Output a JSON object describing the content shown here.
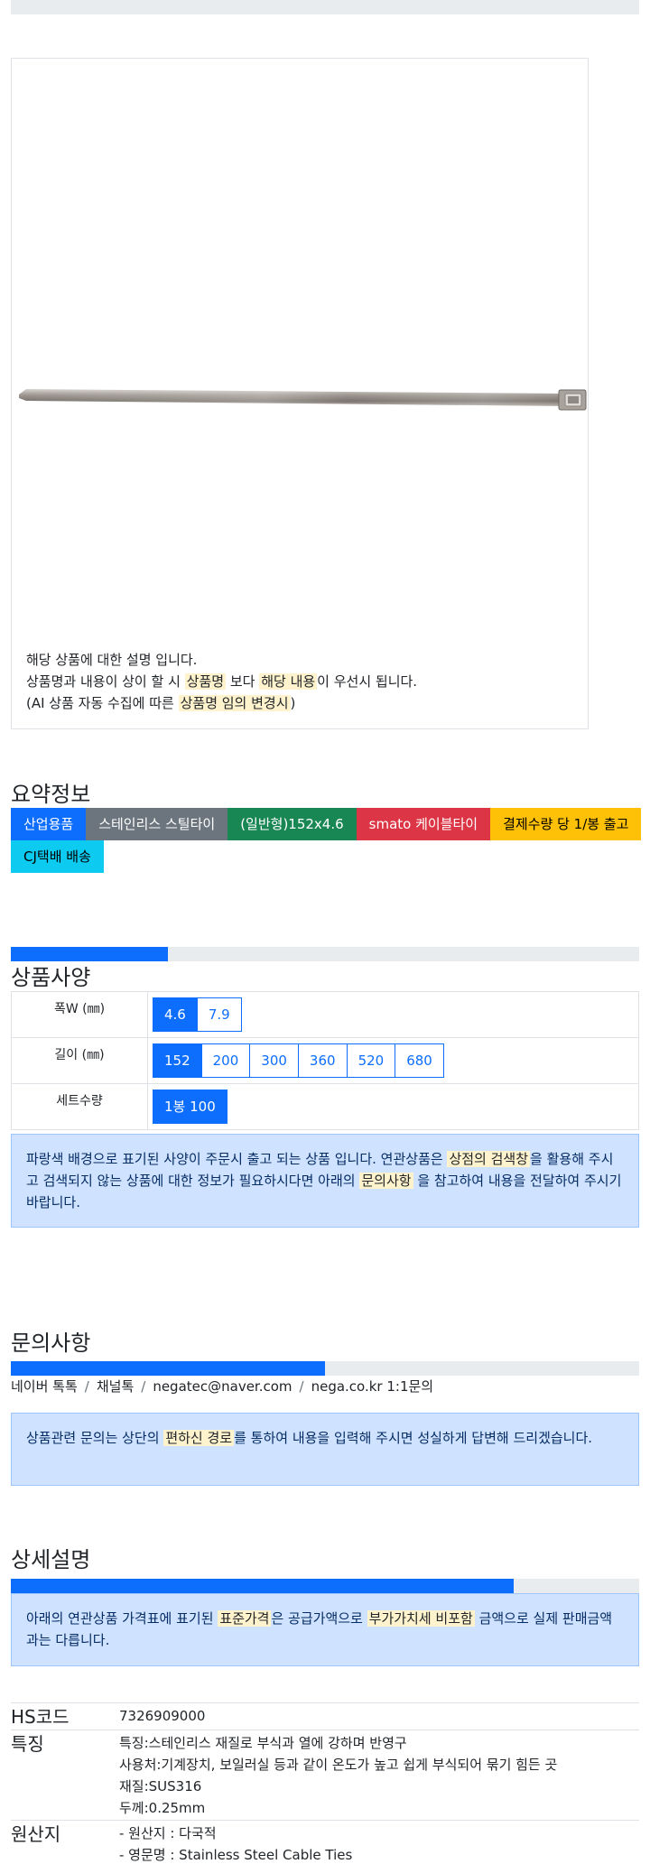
{
  "description": {
    "line1": "해당 상품에 대한 설명 입니다.",
    "line2_pre": "상품명과 내용이 상이 할 시 ",
    "line2_hl1": "상품명",
    "line2_mid": " 보다 ",
    "line2_hl2": "해당 내용",
    "line2_post": "이 우선시 됩니다.",
    "line3_pre": "(AI 상품 자동 수집에 따른 ",
    "line3_hl": "상품명 임의 변경시",
    "line3_post": ")"
  },
  "summary": {
    "title": "요약정보",
    "badges": [
      {
        "label": "산업용품",
        "color": "#0d6efd"
      },
      {
        "label": "스테인리스 스틸타이",
        "color": "#6c757d"
      },
      {
        "label": "(일반형)152x4.6",
        "color": "#198754"
      },
      {
        "label": "smato 케이블타이",
        "color": "#dc3545"
      },
      {
        "label": "결제수량 당 1/봉 출고",
        "color": "#ffc107"
      },
      {
        "label": "CJ택배 배송",
        "color": "#0dcaf0"
      }
    ]
  },
  "spec": {
    "title": "상품사양",
    "progress": 0.25,
    "rows": [
      {
        "label": "폭W (㎜)",
        "options": [
          "4.6",
          "7.9"
        ],
        "selected": "4.6"
      },
      {
        "label": "길이 (㎜)",
        "options": [
          "152",
          "200",
          "300",
          "360",
          "520",
          "680"
        ],
        "selected": "152"
      },
      {
        "label": "세트수량",
        "options": [
          "1봉 100"
        ],
        "selected": "1봉 100"
      }
    ],
    "notice_pre": "파랑색 배경으로 표기된 사양이 주문시 출고 되는 상품 입니다. 연관상품은 ",
    "notice_hl1": "상점의 검색창",
    "notice_mid": "을 활용해 주시고 검색되지 않는 상품에 대한 정보가 필요하시다면 아래의 ",
    "notice_hl2": "문의사항",
    "notice_post": " 을 참고하여 내용을 전달하여 주시기 바랍니다."
  },
  "inquiry": {
    "title": "문의사항",
    "progress": 0.5,
    "links": [
      "네이버 톡톡",
      "채널톡",
      "negatec@naver.com",
      "nega.co.kr 1:1문의"
    ],
    "notice_pre": "상품관련 문의는 상단의 ",
    "notice_hl": "편하신 경로",
    "notice_post": "를 통하여 내용을 입력해 주시면 성실하게 답변해 드리겠습니다."
  },
  "detail": {
    "title": "상세설명",
    "progress": 0.8,
    "notice_pre": "아래의 연관상품 가격표에 표기된 ",
    "notice_hl1": "표준가격",
    "notice_mid": "은 공급가액으로 ",
    "notice_hl2": "부가가치세 비포함",
    "notice_post": " 금액으로 실제 판매금액과는 다릅니다.",
    "info": [
      {
        "key": "HS코드",
        "lines": [
          "7326909000"
        ]
      },
      {
        "key": "특징",
        "lines": [
          "특징:스테인리스 재질로 부식과 열에 강하며 반영구",
          "사용처:기계장치, 보일러실 등과 같이 온도가 높고 쉽게 부식되어 묶기 힘든 곳",
          "재질:SUS316",
          "두께:0.25mm"
        ]
      },
      {
        "key": "원산지",
        "lines": [
          "- 원산지 : 다국적",
          "- 영문명 : Stainless Steel Cable Ties"
        ]
      }
    ]
  }
}
